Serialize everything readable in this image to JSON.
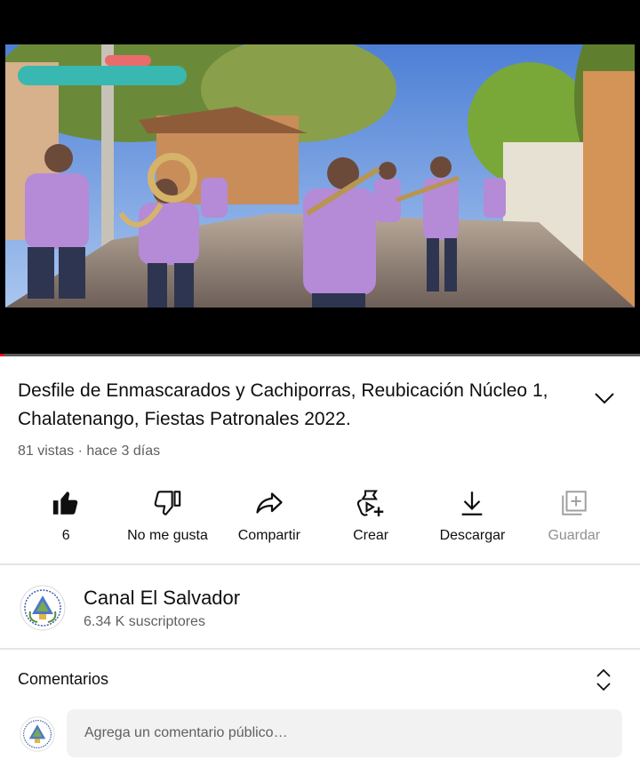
{
  "video": {
    "title": "Desfile de Enmascarados y Cachiporras, Reubicación Núcleo 1, Chalatenango, Fiestas Patronales 2022.",
    "meta": "81 vistas · hace 3 días",
    "progress": 0.005
  },
  "actions": [
    {
      "label": "6",
      "icon": "thumbs-up-icon",
      "enabled": true
    },
    {
      "label": "No me gusta",
      "icon": "thumbs-down-icon",
      "enabled": true
    },
    {
      "label": "Compartir",
      "icon": "share-icon",
      "enabled": true
    },
    {
      "label": "Crear",
      "icon": "create-icon",
      "enabled": true
    },
    {
      "label": "Descargar",
      "icon": "download-icon",
      "enabled": true
    },
    {
      "label": "Guardar",
      "icon": "save-playlist-icon",
      "enabled": false
    }
  ],
  "channel": {
    "name": "Canal El Salvador",
    "subscribers": "6.34 K suscriptores"
  },
  "comments": {
    "heading": "Comentarios",
    "placeholder": "Agrega un comentario público…"
  }
}
